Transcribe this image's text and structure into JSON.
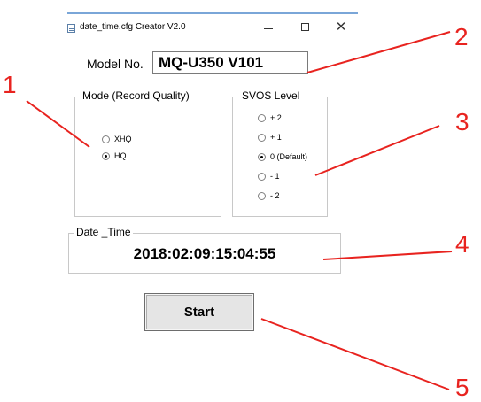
{
  "window": {
    "title": "date_time.cfg Creator V2.0",
    "minimize_icon": "minimize-icon",
    "maximize_icon": "maximize-icon",
    "close_glyph": "✕"
  },
  "model": {
    "label": "Model No.",
    "value": "MQ-U350 V101"
  },
  "mode": {
    "title": "Mode (Record Quality)",
    "options": [
      {
        "label": "XHQ",
        "checked": false
      },
      {
        "label": "HQ",
        "checked": true
      }
    ]
  },
  "svos": {
    "title": "SVOS Level",
    "options": [
      {
        "label": "+ 2",
        "checked": false
      },
      {
        "label": "+ 1",
        "checked": false
      },
      {
        "label": "0 (Default)",
        "checked": true
      },
      {
        "label": "- 1",
        "checked": false
      },
      {
        "label": "- 2",
        "checked": false
      }
    ]
  },
  "date_time": {
    "title": "Date _Time",
    "value": "2018:02:09:15:04:55"
  },
  "start_button": {
    "label": "Start"
  },
  "callouts": [
    "1",
    "2",
    "3",
    "4",
    "5"
  ],
  "colors": {
    "callout": "#e8231f",
    "title_accent": "#7aa6d8"
  }
}
